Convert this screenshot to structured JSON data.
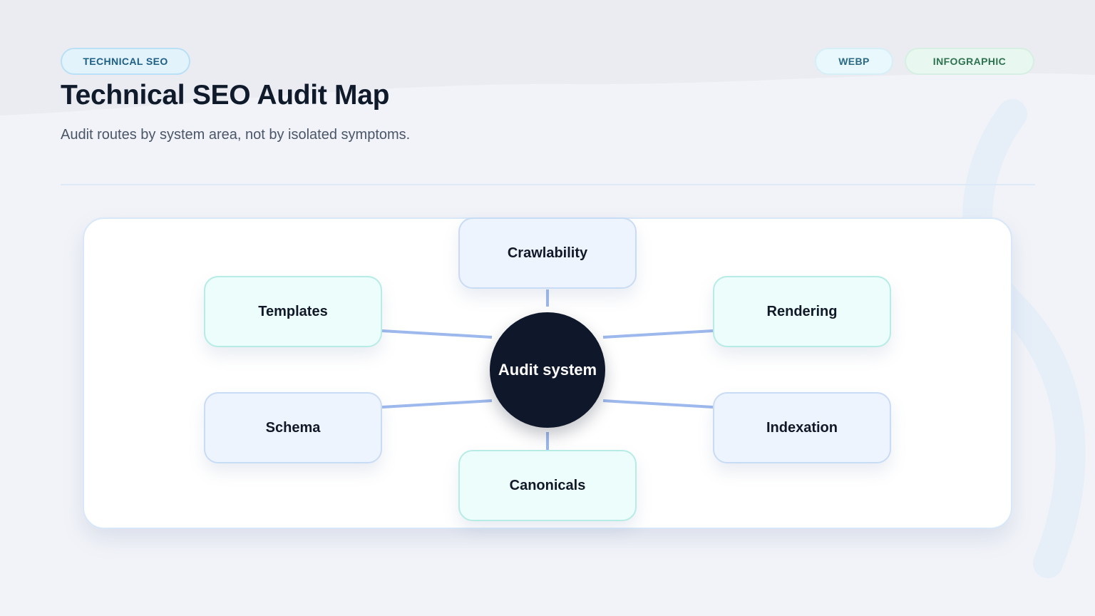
{
  "header": {
    "topic_tag": "TECHNICAL SEO",
    "format_tag": "WEBP",
    "type_tag": "INFOGRAPHIC",
    "title": "Technical SEO Audit Map",
    "subtitle": "Audit routes by system area, not by isolated symptoms."
  },
  "diagram": {
    "hub": "Audit system",
    "nodes": [
      {
        "id": "crawlability",
        "label": "Crawlability",
        "tone": "blue"
      },
      {
        "id": "templates",
        "label": "Templates",
        "tone": "teal"
      },
      {
        "id": "rendering",
        "label": "Rendering",
        "tone": "teal"
      },
      {
        "id": "schema",
        "label": "Schema",
        "tone": "blue"
      },
      {
        "id": "indexation",
        "label": "Indexation",
        "tone": "blue"
      },
      {
        "id": "canonicals",
        "label": "Canonicals",
        "tone": "teal"
      }
    ]
  },
  "colors": {
    "hub": "#0f172a",
    "link": "#9db8ec",
    "teal_node": "#ecfdfb",
    "blue_node": "#eef4fd",
    "title": "#0f1a2b"
  }
}
